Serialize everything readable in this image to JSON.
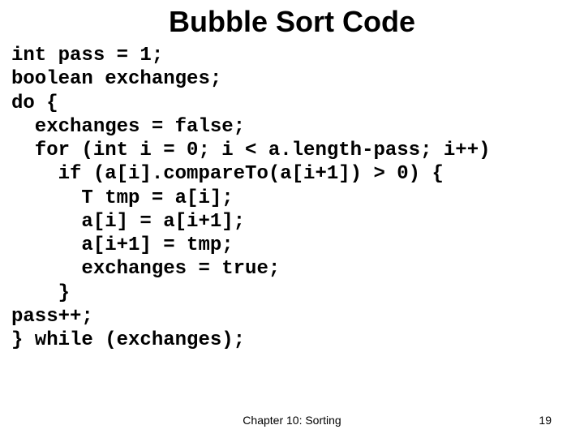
{
  "title": "Bubble Sort Code",
  "code": {
    "l1": "int pass = 1;",
    "l2": "boolean exchanges;",
    "l3": "do {",
    "l4": "  exchanges = false;",
    "l5": "  for (int i = 0; i < a.length-pass; i++)",
    "l6": "    if (a[i].compareTo(a[i+1]) > 0) {",
    "l7": "      T tmp = a[i];",
    "l8": "      a[i] = a[i+1];",
    "l9": "      a[i+1] = tmp;",
    "l10": "      exchanges = true;",
    "l11": "    }",
    "l12": "pass++;",
    "l13": "} while (exchanges);"
  },
  "footer": {
    "chapter": "Chapter 10: Sorting",
    "page": "19"
  }
}
